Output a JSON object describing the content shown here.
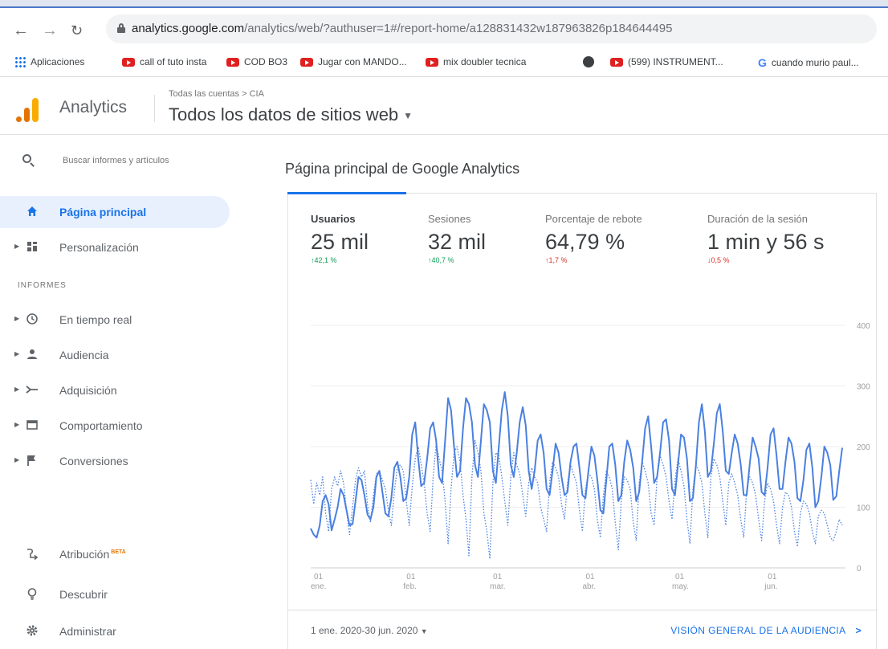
{
  "browser": {
    "url_host": "analytics.google.com",
    "url_path": "/analytics/web/?authuser=1#/report-home/a128831432w187963826p184644495",
    "bookmarks": [
      {
        "label": "Aplicaciones",
        "icon": "apps-grid-icon"
      },
      {
        "label": "call of tuto insta",
        "icon": "youtube-icon"
      },
      {
        "label": "COD BO3",
        "icon": "youtube-icon"
      },
      {
        "label": "Jugar con MANDO...",
        "icon": "youtube-icon"
      },
      {
        "label": "mix doubler tecnica",
        "icon": "youtube-icon"
      },
      {
        "label": "",
        "icon": "globe-icon"
      },
      {
        "label": "(599) INSTRUMENT...",
        "icon": "youtube-icon"
      },
      {
        "label": "cuando murio paul...",
        "icon": "google-icon"
      }
    ]
  },
  "header": {
    "app_name": "Analytics",
    "breadcrumb": "Todas las cuentas > CIA",
    "view_name": "Todos los datos de sitios web"
  },
  "sidebar": {
    "search_placeholder": "Buscar informes y artículos",
    "section_label": "INFORMES",
    "items": [
      {
        "label": "Página principal",
        "icon": "home-icon"
      },
      {
        "label": "Personalización",
        "icon": "dashboard-icon"
      },
      {
        "label": "En tiempo real",
        "icon": "clock-icon"
      },
      {
        "label": "Audiencia",
        "icon": "person-icon"
      },
      {
        "label": "Adquisición",
        "icon": "acquisition-icon"
      },
      {
        "label": "Comportamiento",
        "icon": "window-icon"
      },
      {
        "label": "Conversiones",
        "icon": "flag-icon"
      },
      {
        "label": "Atribución",
        "badge": "BETA",
        "icon": "attribution-icon"
      },
      {
        "label": "Descubrir",
        "icon": "lightbulb-icon"
      },
      {
        "label": "Administrar",
        "icon": "gear-icon"
      }
    ]
  },
  "main": {
    "title": "Página principal de Google Analytics",
    "metrics": [
      {
        "label": "Usuarios",
        "value": "25 mil",
        "delta": "↑42,1 %",
        "trend": "up"
      },
      {
        "label": "Sesiones",
        "value": "32 mil",
        "delta": "↑40,7 %",
        "trend": "up"
      },
      {
        "label": "Porcentaje de rebote",
        "value": "64,79 %",
        "delta": "↑1,7 %",
        "trend": "down"
      },
      {
        "label": "Duración de la sesión",
        "value": "1 min y 56 s",
        "delta": "↓0,5 %",
        "trend": "down"
      }
    ],
    "date_range": "1 ene. 2020-30 jun. 2020",
    "audience_link": "VISIÓN GENERAL DE LA AUDIENCIA"
  },
  "colors": {
    "accent": "#1a73e8",
    "series": "#4a80e0",
    "up": "#0f9d58",
    "down": "#d93025"
  },
  "chart_data": {
    "type": "line",
    "y_ticks": [
      "0",
      "100",
      "200",
      "300",
      "400"
    ],
    "ylim": [
      0,
      400
    ],
    "x_ticks": [
      {
        "day": "01",
        "month": "ene."
      },
      {
        "day": "01",
        "month": "feb."
      },
      {
        "day": "01",
        "month": "mar."
      },
      {
        "day": "01",
        "month": "abr."
      },
      {
        "day": "01",
        "month": "may."
      },
      {
        "day": "01",
        "month": "jun."
      }
    ],
    "x_tick_index": [
      0,
      31,
      60,
      91,
      121,
      152
    ],
    "grid": true,
    "series": [
      {
        "style": "solid",
        "values": [
          65,
          55,
          50,
          70,
          110,
          120,
          105,
          62,
          80,
          100,
          130,
          120,
          95,
          70,
          72,
          110,
          150,
          145,
          120,
          88,
          80,
          100,
          150,
          160,
          125,
          90,
          85,
          115,
          165,
          175,
          150,
          110,
          115,
          150,
          220,
          240,
          180,
          135,
          140,
          180,
          230,
          240,
          210,
          150,
          140,
          210,
          280,
          260,
          200,
          150,
          160,
          230,
          280,
          270,
          240,
          170,
          150,
          210,
          270,
          260,
          240,
          160,
          140,
          200,
          260,
          290,
          250,
          170,
          150,
          190,
          240,
          265,
          235,
          160,
          130,
          160,
          210,
          220,
          190,
          130,
          120,
          160,
          205,
          190,
          150,
          120,
          125,
          175,
          200,
          205,
          165,
          120,
          115,
          160,
          200,
          185,
          145,
          95,
          90,
          145,
          200,
          205,
          170,
          110,
          120,
          175,
          210,
          195,
          165,
          110,
          125,
          175,
          230,
          250,
          200,
          140,
          150,
          190,
          240,
          245,
          210,
          130,
          120,
          170,
          220,
          215,
          180,
          110,
          115,
          170,
          240,
          270,
          225,
          150,
          160,
          205,
          255,
          270,
          225,
          160,
          155,
          190,
          220,
          205,
          170,
          120,
          120,
          170,
          215,
          200,
          180,
          125,
          120,
          165,
          220,
          230,
          185,
          130,
          130,
          175,
          215,
          205,
          175,
          115,
          110,
          145,
          195,
          205,
          165,
          100,
          110,
          150,
          200,
          190,
          170,
          112,
          118,
          160,
          198
        ]
      },
      {
        "style": "dotted",
        "values": [
          145,
          105,
          140,
          120,
          150,
          90,
          60,
          130,
          150,
          135,
          160,
          140,
          95,
          55,
          100,
          145,
          165,
          150,
          160,
          105,
          75,
          120,
          155,
          160,
          145,
          130,
          95,
          70,
          125,
          165,
          170,
          160,
          110,
          70,
          135,
          180,
          200,
          170,
          140,
          90,
          60,
          150,
          205,
          180,
          160,
          110,
          40,
          130,
          190,
          200,
          175,
          120,
          80,
          20,
          150,
          210,
          190,
          160,
          90,
          60,
          15,
          140,
          190,
          185,
          150,
          110,
          70,
          150,
          190,
          170,
          155,
          120,
          85,
          140,
          165,
          150,
          140,
          100,
          80,
          60,
          140,
          175,
          165,
          150,
          105,
          80,
          140,
          170,
          155,
          140,
          95,
          60,
          130,
          155,
          150,
          130,
          80,
          50,
          120,
          160,
          150,
          130,
          75,
          30,
          110,
          150,
          145,
          130,
          75,
          45,
          140,
          175,
          160,
          140,
          90,
          70,
          150,
          185,
          170,
          150,
          110,
          80,
          145,
          180,
          160,
          135,
          80,
          40,
          130,
          170,
          160,
          140,
          90,
          50,
          150,
          180,
          170,
          150,
          110,
          70,
          140,
          155,
          140,
          120,
          80,
          50,
          130,
          150,
          140,
          120,
          80,
          45,
          110,
          140,
          130,
          110,
          70,
          40,
          100,
          125,
          120,
          100,
          60,
          35,
          90,
          110,
          105,
          90,
          60,
          40,
          85,
          95,
          90,
          70,
          50,
          45,
          60,
          80,
          70
        ]
      }
    ]
  }
}
